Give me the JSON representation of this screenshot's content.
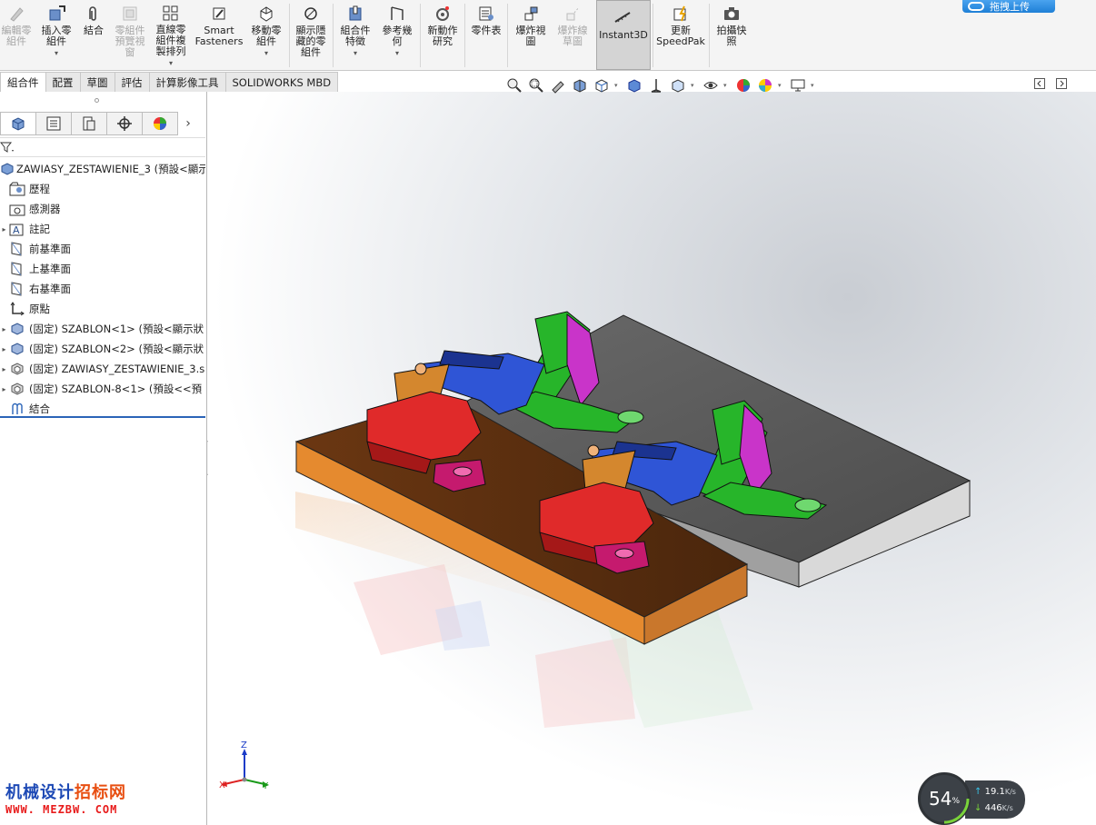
{
  "ribbon": {
    "buttons": [
      {
        "label": "編輯零\n組件",
        "enabled": false,
        "icon": "edit-component-icon"
      },
      {
        "label": "插入零\n組件",
        "enabled": true,
        "icon": "insert-component-icon",
        "dropdown": true
      },
      {
        "label": "結合",
        "enabled": true,
        "icon": "mate-paperclip-icon"
      },
      {
        "label": "零組件\n預覽視\n窗",
        "enabled": false,
        "icon": "component-preview-icon"
      },
      {
        "label": "直線零\n組件複\n製排列",
        "enabled": true,
        "icon": "linear-pattern-icon",
        "dropdown": true
      },
      {
        "label": "Smart\nFasteners",
        "enabled": true,
        "icon": "smart-fasteners-icon"
      },
      {
        "label": "移動零\n組件",
        "enabled": true,
        "icon": "move-component-icon",
        "dropdown": true
      },
      {
        "label": "顯示隱\n藏的零\n組件",
        "enabled": true,
        "icon": "show-hidden-icon"
      },
      {
        "label": "組合件\n特徵",
        "enabled": true,
        "icon": "assembly-features-icon",
        "dropdown": true
      },
      {
        "label": "參考幾\n何",
        "enabled": true,
        "icon": "reference-geometry-icon",
        "dropdown": true
      },
      {
        "label": "新動作\n研究",
        "enabled": true,
        "icon": "motion-study-icon"
      },
      {
        "label": "零件表",
        "enabled": true,
        "icon": "bom-icon"
      },
      {
        "label": "爆炸視\n圖",
        "enabled": true,
        "icon": "exploded-view-icon"
      },
      {
        "label": "爆炸線\n草圖",
        "enabled": false,
        "icon": "explode-line-sketch-icon"
      },
      {
        "label": "Instant3D",
        "enabled": true,
        "icon": "instant3d-icon",
        "active": true
      },
      {
        "label": "更新\nSpeedPak",
        "enabled": true,
        "icon": "speedpak-icon"
      },
      {
        "label": "拍攝快\n照",
        "enabled": true,
        "icon": "camera-icon"
      }
    ],
    "upload_label": "拖拽上传"
  },
  "tabs": [
    "組合件",
    "配置",
    "草圖",
    "評估",
    "計算影像工具",
    "SOLIDWORKS MBD"
  ],
  "active_tab": 0,
  "tree": {
    "root": "ZAWIASY_ZESTAWIENIE_3  (預設<顯示",
    "items": [
      {
        "label": "歷程",
        "icon": "history-folder-icon",
        "expandable": false
      },
      {
        "label": "感測器",
        "icon": "sensor-icon",
        "expandable": false
      },
      {
        "label": "註記",
        "icon": "annotations-icon",
        "expandable": true
      },
      {
        "label": "前基準面",
        "icon": "plane-icon",
        "expandable": false
      },
      {
        "label": "上基準面",
        "icon": "plane-icon",
        "expandable": false
      },
      {
        "label": "右基準面",
        "icon": "plane-icon",
        "expandable": false
      },
      {
        "label": "原點",
        "icon": "origin-icon",
        "expandable": false
      },
      {
        "label": "(固定) SZABLON<1> (預設<顯示狀",
        "icon": "part-icon",
        "expandable": true
      },
      {
        "label": "(固定) SZABLON<2> (預設<顯示狀",
        "icon": "part-icon",
        "expandable": true
      },
      {
        "label": "(固定) ZAWIASY_ZESTAWIENIE_3.s",
        "icon": "subassembly-icon",
        "expandable": true
      },
      {
        "label": "(固定) SZABLON-8<1> (預設<<預",
        "icon": "subassembly-icon",
        "expandable": true
      },
      {
        "label": "結合",
        "icon": "mates-icon",
        "expandable": false
      }
    ]
  },
  "triad": {
    "x": "X",
    "y": "Y",
    "z": "Z"
  },
  "watermark": {
    "title_a": "机械设计",
    "title_b": "招标网",
    "url": "WWW. MEZBW. COM"
  },
  "netmon": {
    "percent": "54",
    "percent_unit": "%",
    "up": "19.1",
    "down": "446",
    "up_unit": "K/s",
    "down_unit": "K/s"
  },
  "colors": {
    "accent": "#2b64b8",
    "plate_orange": "#c9772c",
    "plate_grey": "#5c5c5c",
    "part_blue": "#2f55d6",
    "part_red": "#e02a2a",
    "part_green": "#27b52a",
    "part_magenta": "#c934c9"
  }
}
